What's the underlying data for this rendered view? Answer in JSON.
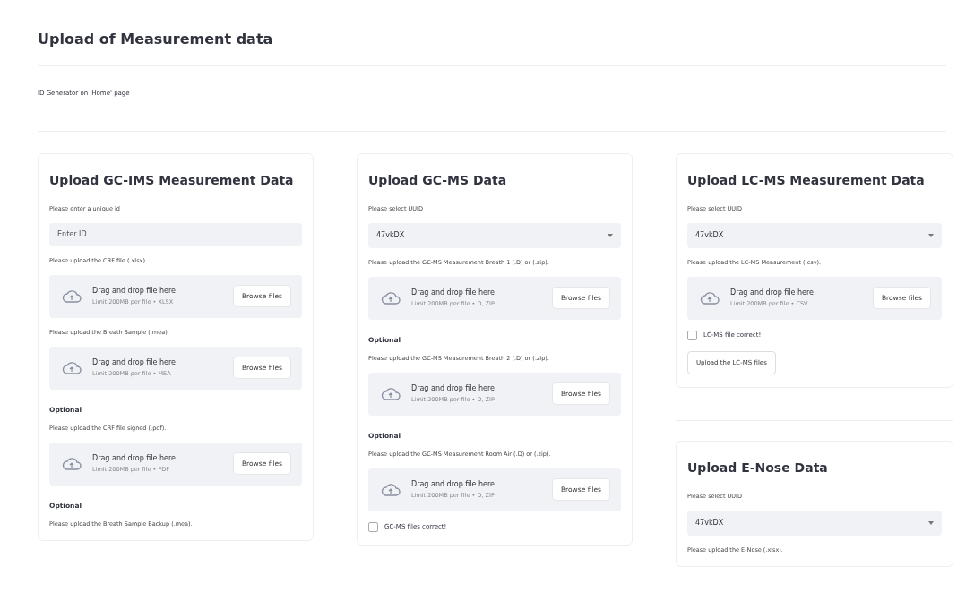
{
  "page_title": "Upload of Measurement data",
  "note": "ID Generator on 'Home' page",
  "columns": [
    {
      "cards": [
        {
          "title": "Upload GC-IMS Measurement Data",
          "items": [
            {
              "kind": "label",
              "text": "Please enter a unique id"
            },
            {
              "kind": "text_input",
              "placeholder": "Enter ID"
            },
            {
              "kind": "label",
              "text": "Please upload the CRF file (.xlsx)."
            },
            {
              "kind": "dropzone",
              "text": "Drag and drop file here",
              "limit": "Limit 200MB per file • XLSX",
              "button": "Browse files"
            },
            {
              "kind": "label",
              "text": "Please upload the Breath Sample (.mea)."
            },
            {
              "kind": "dropzone",
              "text": "Drag and drop file here",
              "limit": "Limit 200MB per file • MEA",
              "button": "Browse files"
            },
            {
              "kind": "optional",
              "text": "Optional"
            },
            {
              "kind": "label",
              "text": "Please upload the CRF file signed (.pdf)."
            },
            {
              "kind": "dropzone",
              "text": "Drag and drop file here",
              "limit": "Limit 200MB per file • PDF",
              "button": "Browse files"
            },
            {
              "kind": "optional",
              "text": "Optional"
            },
            {
              "kind": "label",
              "text": "Please upload the Breath Sample Backup (.mea)."
            }
          ]
        }
      ]
    },
    {
      "cards": [
        {
          "title": "Upload GC-MS Data",
          "items": [
            {
              "kind": "label",
              "text": "Please select UUID"
            },
            {
              "kind": "select",
              "value": "47vkDX"
            },
            {
              "kind": "label",
              "text": "Please upload the GC-MS Measurement Breath 1 (.D) or (.zip)."
            },
            {
              "kind": "dropzone",
              "text": "Drag and drop file here",
              "limit": "Limit 200MB per file • D, ZIP",
              "button": "Browse files"
            },
            {
              "kind": "optional",
              "text": "Optional"
            },
            {
              "kind": "label",
              "text": "Please upload the GC-MS Measurement Breath 2 (.D) or (.zip)."
            },
            {
              "kind": "dropzone",
              "text": "Drag and drop file here",
              "limit": "Limit 200MB per file • D, ZIP",
              "button": "Browse files"
            },
            {
              "kind": "optional",
              "text": "Optional"
            },
            {
              "kind": "label",
              "text": "Please upload the GC-MS Measurement Room Air (.D) or (.zip)."
            },
            {
              "kind": "dropzone",
              "text": "Drag and drop file here",
              "limit": "Limit 200MB per file • D, ZIP",
              "button": "Browse files"
            },
            {
              "kind": "checkbox",
              "text": "GC-MS files correct!",
              "checked": false
            }
          ]
        }
      ]
    },
    {
      "cards": [
        {
          "title": "Upload LC-MS Measurement Data",
          "items": [
            {
              "kind": "label",
              "text": "Please select UUID"
            },
            {
              "kind": "select",
              "value": "47vkDX"
            },
            {
              "kind": "label",
              "text": "Please upload the LC-MS Measurement (.csv)."
            },
            {
              "kind": "dropzone",
              "text": "Drag and drop file here",
              "limit": "Limit 200MB per file • CSV",
              "button": "Browse files"
            },
            {
              "kind": "checkbox",
              "text": "LC-MS file correct!",
              "checked": false
            },
            {
              "kind": "button",
              "text": "Upload the LC-MS files"
            }
          ]
        },
        {
          "title": "Upload E-Nose Data",
          "items": [
            {
              "kind": "label",
              "text": "Please select UUID"
            },
            {
              "kind": "select",
              "value": "47vkDX"
            },
            {
              "kind": "label",
              "text": "Please upload the E-Nose (.xlsx)."
            }
          ]
        }
      ]
    }
  ]
}
